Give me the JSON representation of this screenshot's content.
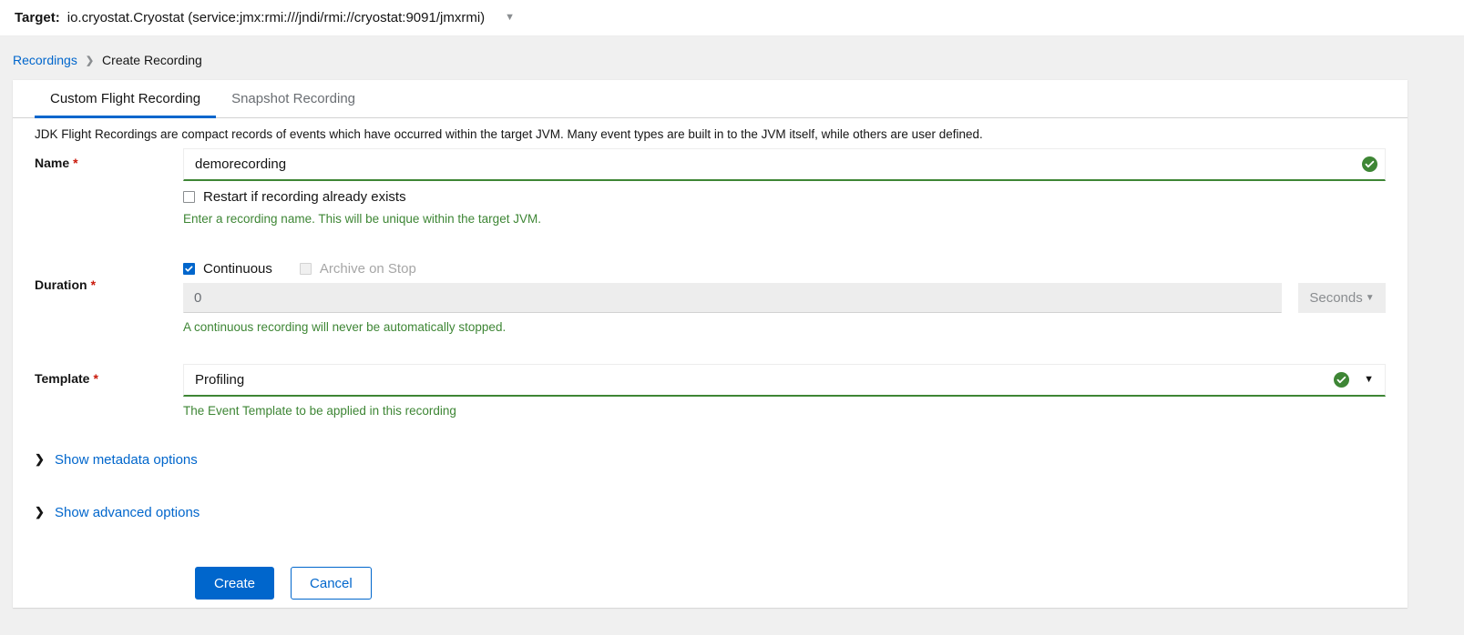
{
  "target_bar": {
    "label": "Target:",
    "value": "io.cryostat.Cryostat (service:jmx:rmi:///jndi/rmi://cryostat:9091/jmxrmi)",
    "caret_icon": "chevron-down-icon"
  },
  "breadcrumb": {
    "parent": "Recordings",
    "separator": "❯",
    "current": "Create Recording"
  },
  "tabs": [
    {
      "label": "Custom Flight Recording",
      "active": true
    },
    {
      "label": "Snapshot Recording",
      "active": false
    }
  ],
  "form": {
    "intro": "JDK Flight Recordings are compact records of events which have occurred within the target JVM. Many event types are built in to the JVM itself, while others are user defined.",
    "required_marker": "*",
    "name": {
      "label": "Name",
      "value": "demorecording",
      "placeholder": "",
      "valid_icon": "check-circle-icon",
      "restart_checkbox_label": "Restart if recording already exists",
      "restart_checked": false,
      "helper": "Enter a recording name. This will be unique within the target JVM."
    },
    "duration": {
      "label": "Duration",
      "continuous_label": "Continuous",
      "continuous_checked": true,
      "archive_label": "Archive on Stop",
      "archive_checked": false,
      "archive_disabled": true,
      "value": "0",
      "unit": "Seconds",
      "unit_caret_icon": "caret-down-icon",
      "helper": "A continuous recording will never be automatically stopped."
    },
    "template": {
      "label": "Template",
      "value": "Profiling",
      "valid_icon": "check-circle-icon",
      "caret_icon": "caret-down-icon",
      "helper": "The Event Template to be applied in this recording"
    }
  },
  "expandables": [
    {
      "label": "Show metadata options",
      "icon": "chevron-right-icon"
    },
    {
      "label": "Show advanced options",
      "icon": "chevron-right-icon"
    }
  ],
  "actions": {
    "create": "Create",
    "cancel": "Cancel"
  },
  "colors": {
    "accent_blue": "#0066cc",
    "success_green": "#3e8635",
    "required_red": "#c9190b",
    "page_bg": "#f0f0f0"
  }
}
